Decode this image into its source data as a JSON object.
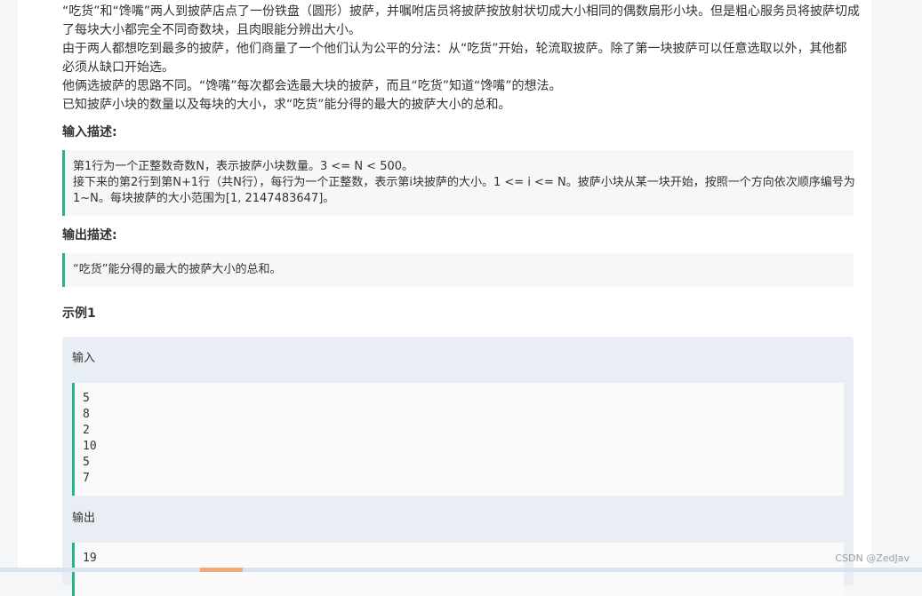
{
  "problem": {
    "paragraphs": [
      "“吃货”和“馋嘴”两人到披萨店点了一份铁盘（圆形）披萨，并嘱咐店员将披萨按放射状切成大小相同的偶数扇形小块。但是粗心服务员将披萨切成",
      "了每块大小都完全不同奇数块，且肉眼能分辨出大小。",
      "由于两人都想吃到最多的披萨，他们商量了一个他们认为公平的分法：从“吃货”开始，轮流取披萨。除了第一块披萨可以任意选取以外，其他都",
      "必须从缺口开始选。",
      "他俩选披萨的思路不同。“馋嘴”每次都会选最大块的披萨，而且“吃货”知道“馋嘴”的想法。",
      "已知披萨小块的数量以及每块的大小，求“吃货”能分得的最大的披萨大小的总和。"
    ]
  },
  "input_section": {
    "title": "输入描述:",
    "lines": [
      "第1行为一个正整数奇数N，表示披萨小块数量。3 <= N < 500。",
      "接下来的第2行到第N+1行（共N行），每行为一个正整数，表示第i块披萨的大小。1 <= i <= N。披萨小块从某一块开始，按照一个方向依次顺序编号为",
      "1~N。每块披萨的大小范围为[1, 2147483647]。"
    ]
  },
  "output_section": {
    "title": "输出描述:",
    "lines": [
      "“吃货”能分得的最大的披萨大小的总和。"
    ]
  },
  "example": {
    "title": "示例1",
    "input_label": "输入",
    "input_lines": [
      "5",
      "8",
      "2",
      "10",
      "5",
      "7"
    ],
    "output_label": "输出",
    "output_lines": [
      "19"
    ]
  },
  "watermark": "CSDN @ZedJav",
  "colors": {
    "accent_bar": "#28b28c",
    "quote_bg": "#f6f7f8",
    "example_bg": "#e9eef5"
  }
}
